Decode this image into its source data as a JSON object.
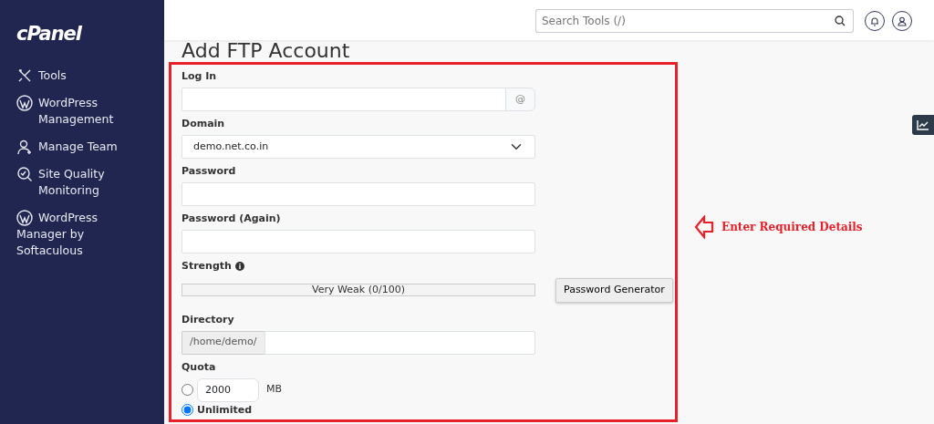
{
  "brand": "cPanel",
  "sidebar": {
    "items": [
      {
        "kind": "tools",
        "label": "Tools"
      },
      {
        "kind": "wordpress",
        "label": "WordPress Management"
      },
      {
        "kind": "team",
        "label": "Manage Team"
      },
      {
        "kind": "quality",
        "label": "Site Quality Monitoring"
      },
      {
        "kind": "wordpress",
        "label": "WordPress Manager by Softaculous"
      }
    ]
  },
  "header": {
    "search": {
      "placeholder": "Search Tools (/)"
    }
  },
  "page_title": "Add FTP Account",
  "form": {
    "login": {
      "label": "Log In",
      "addon": "@"
    },
    "domain": {
      "label": "Domain",
      "value": "demo.net.co.in"
    },
    "password": {
      "label": "Password"
    },
    "password_again": {
      "label": "Password (Again)"
    },
    "strength": {
      "label": "Strength",
      "level": 0,
      "reading": "Very Weak (0/100)",
      "generator_button": "Password Generator"
    },
    "directory": {
      "label": "Directory",
      "prefix": "/home/demo/"
    },
    "quota": {
      "label": "Quota",
      "options": [
        {
          "kind": "amount",
          "value": "2000",
          "unit": "MB",
          "selected": false
        },
        {
          "kind": "unlimited",
          "label": "Unlimited",
          "selected": true
        }
      ]
    }
  },
  "annotation": {
    "text": "Enter Required Details"
  }
}
